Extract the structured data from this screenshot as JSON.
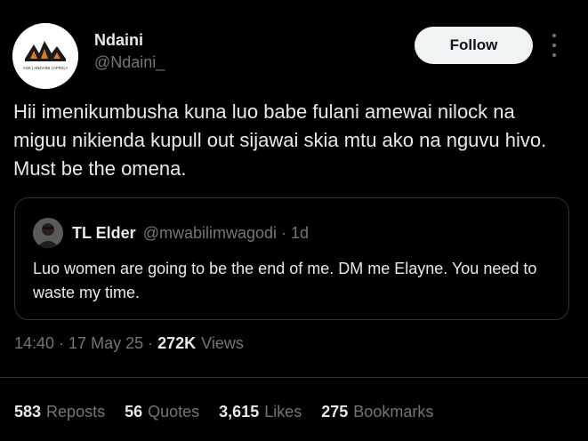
{
  "author": {
    "display_name": "Ndaini",
    "handle": "@Ndaini_",
    "avatar_icon": "afrobranding-logo",
    "avatar_text": "ASK | ANDAINI | AFRICA"
  },
  "follow_label": "Follow",
  "tweet": {
    "text": "Hii imenikumbusha kuna luo babe fulani amewai nilock na miguu nikienda kupull out sijawai skia mtu ako na nguvu hivo. Must be the omena."
  },
  "quote": {
    "name": "TL Elder",
    "handle": "@mwabilimwagodi",
    "separator": "·",
    "age": "1d",
    "text": "Luo women are going to be the end of me. DM me Elayne. You need to waste my time."
  },
  "meta": {
    "time": "14:40",
    "date": "17 May 25",
    "views_count": "272K",
    "views_label": "Views",
    "separator": "·"
  },
  "stats": [
    {
      "count": "583",
      "label": "Reposts"
    },
    {
      "count": "56",
      "label": "Quotes"
    },
    {
      "count": "3,615",
      "label": "Likes"
    },
    {
      "count": "275",
      "label": "Bookmarks"
    }
  ],
  "colors": {
    "background": "#000000",
    "text": "#e7e9ea",
    "muted": "#71767b",
    "border": "#2f3336",
    "accent": "#e07a1a"
  }
}
